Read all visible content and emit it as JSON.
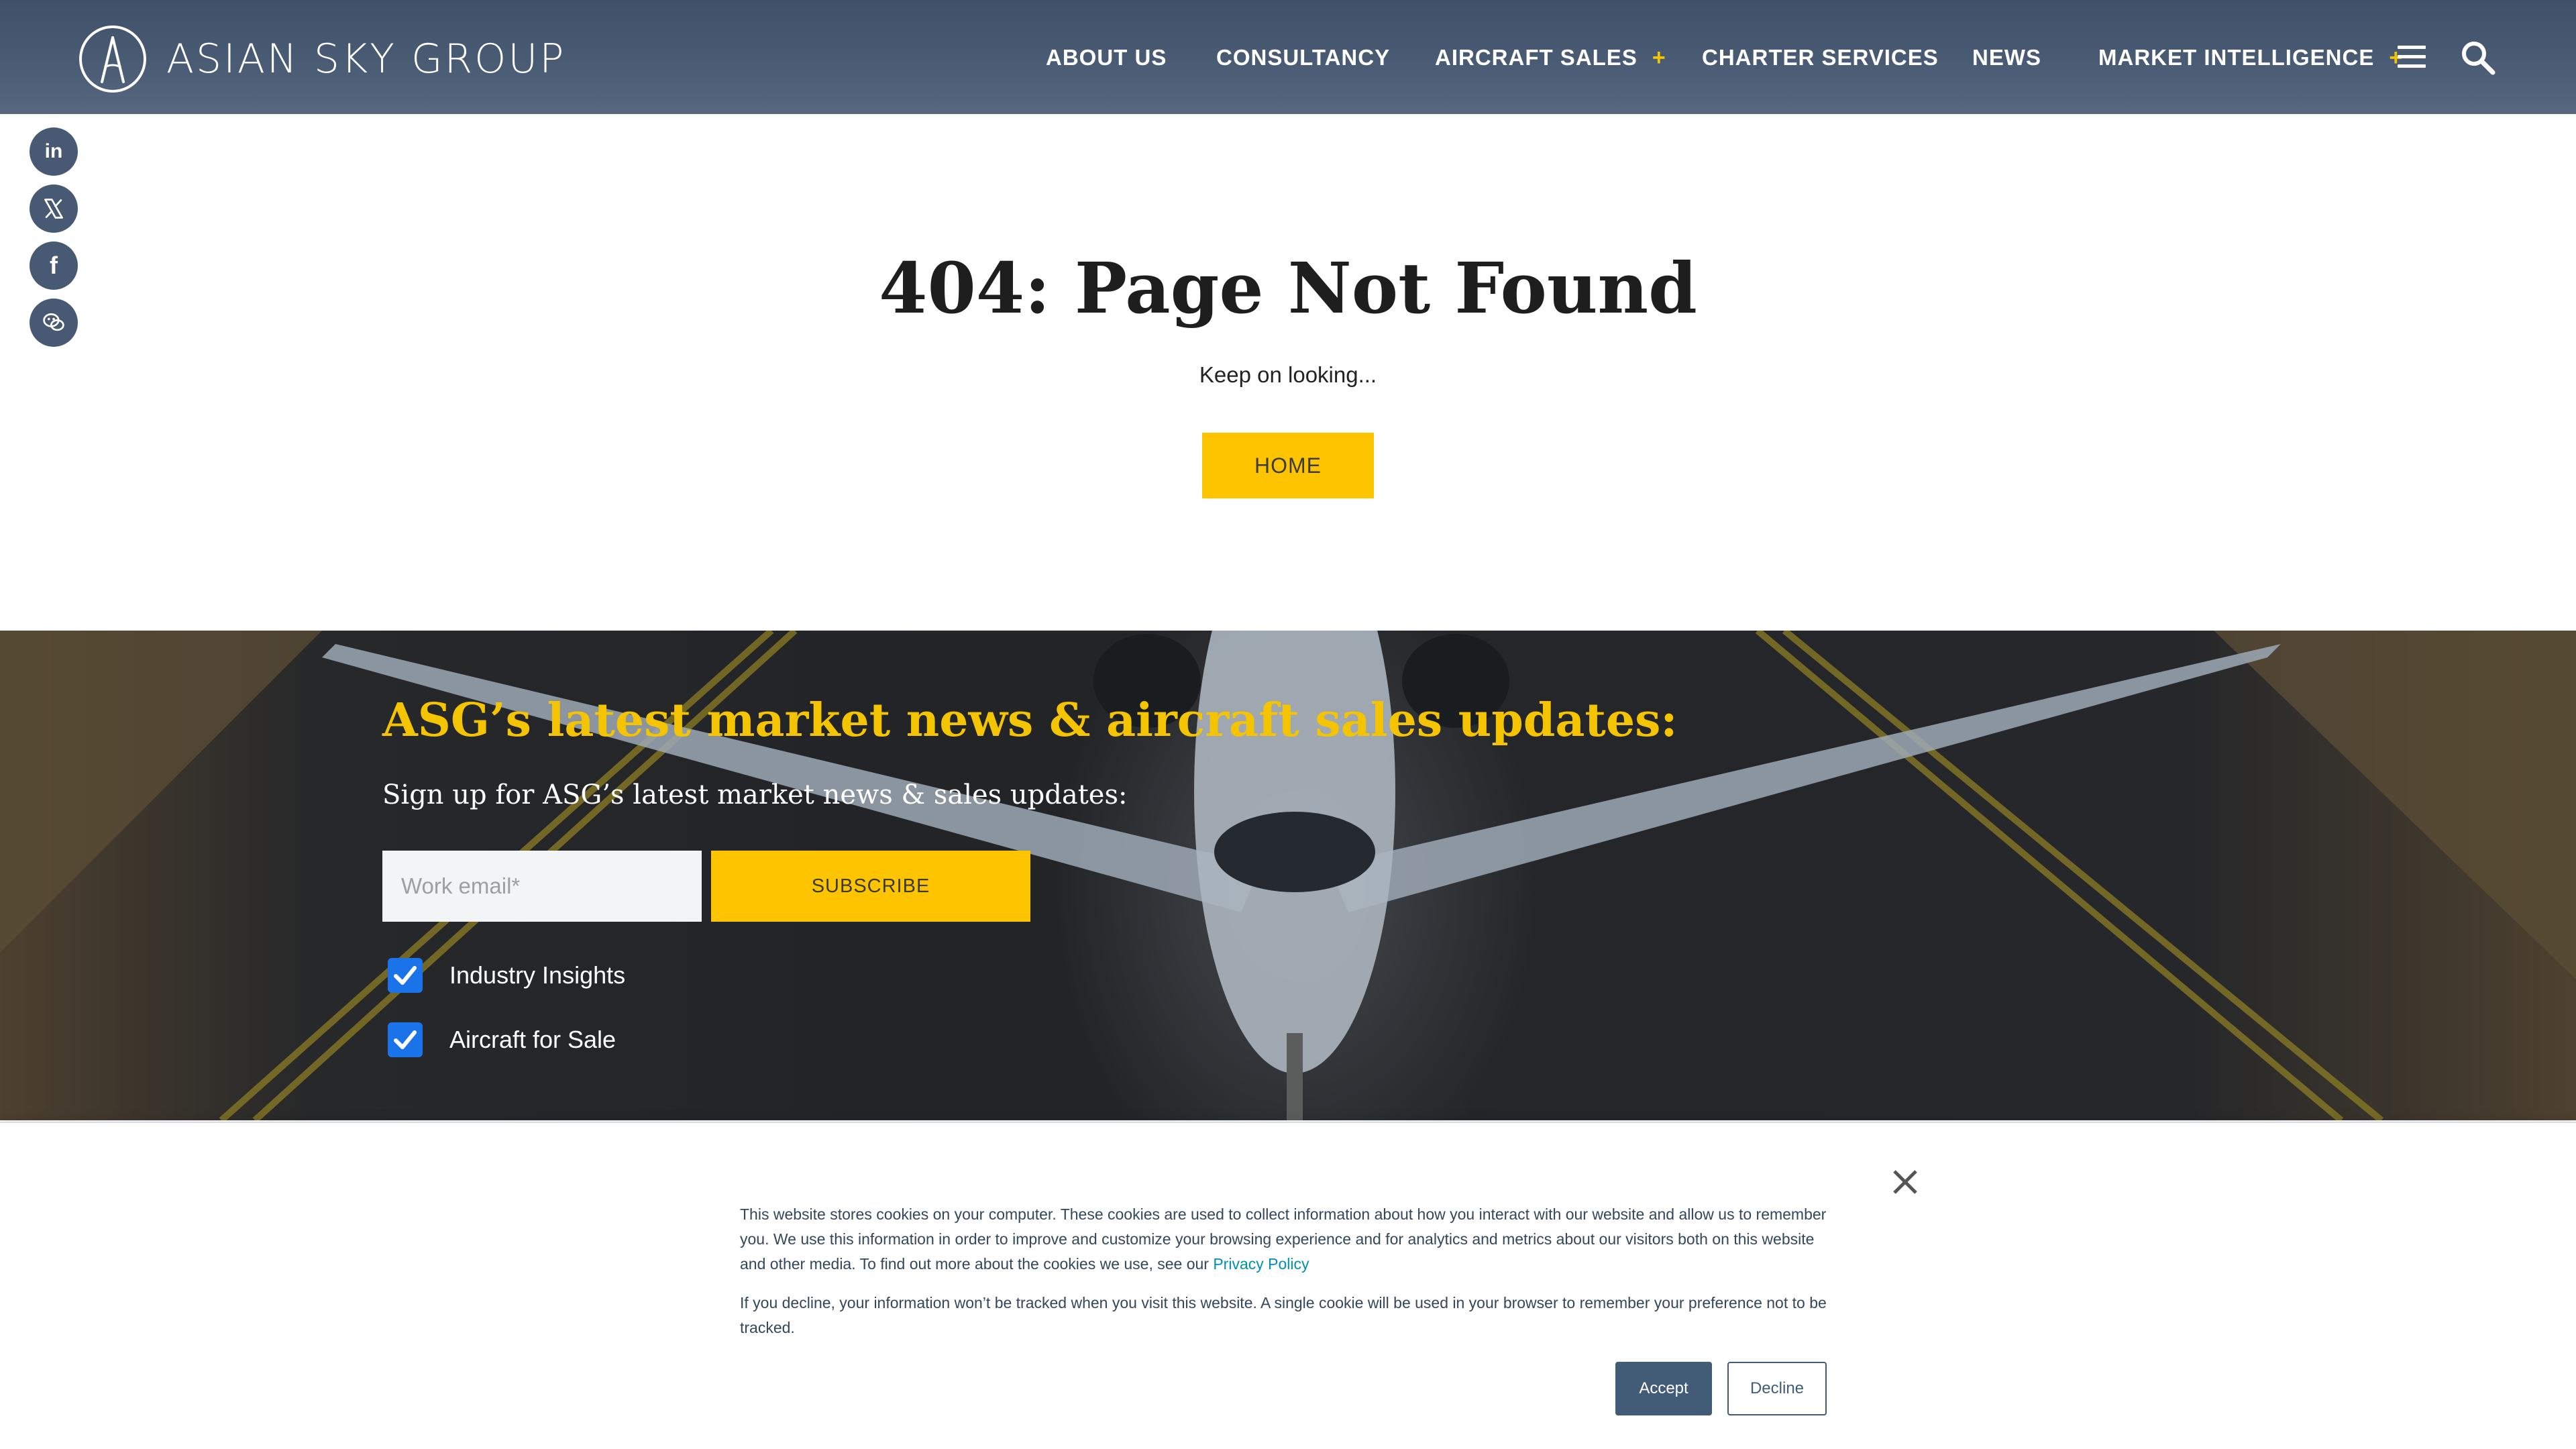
{
  "header": {
    "brand_name": "ASIAN SKY GROUP",
    "nav": {
      "about": "ABOUT US",
      "consultancy": "CONSULTANCY",
      "aircraft_sales": "AIRCRAFT SALES",
      "charter": "CHARTER SERVICES",
      "news": "NEWS",
      "market_intelligence": "MARKET INTELLIGENCE",
      "expand_symbol": "+"
    },
    "menu_icon": "hamburger-menu-icon",
    "search_icon": "search-icon"
  },
  "social": {
    "linkedin_glyph": "in",
    "facebook_glyph": "f",
    "icons": [
      "linkedin-icon",
      "x-icon",
      "facebook-icon",
      "wechat-icon"
    ]
  },
  "main": {
    "title": "404: Page Not Found",
    "subtitle": "Keep on looking...",
    "home_button": "HOME"
  },
  "newsletter": {
    "heading": "ASG’s latest market news & aircraft sales updates:",
    "subheading": "Sign up for ASG’s latest market news & sales updates:",
    "email_placeholder": "Work email*",
    "email_value": "",
    "subscribe_button": "SUBSCRIBE",
    "options": [
      {
        "label": "Industry Insights",
        "checked": true
      },
      {
        "label": "Aircraft for Sale",
        "checked": true
      }
    ]
  },
  "cookie_banner": {
    "paragraph1": "This website stores cookies on your computer. These cookies are used to collect information about how you interact with our website and allow us to remember you. We use this information in order to improve and customize your browsing experience and for analytics and metrics about our visitors both on this website and other media. To find out more about the cookies we use, see our ",
    "privacy_link": "Privacy Policy",
    "paragraph2": "If you decline, your information won’t be tracked when you visit this website. A single cookie will be used in your browser to remember your preference not to be tracked.",
    "accept": "Accept",
    "decline": "Decline"
  },
  "colors": {
    "header_bg": "#4a5b74",
    "accent_yellow": "#ffc400",
    "social_bg": "#485a73",
    "checkbox_blue": "#1a73e8",
    "cookie_button": "#425b76",
    "link": "#0091ae"
  }
}
